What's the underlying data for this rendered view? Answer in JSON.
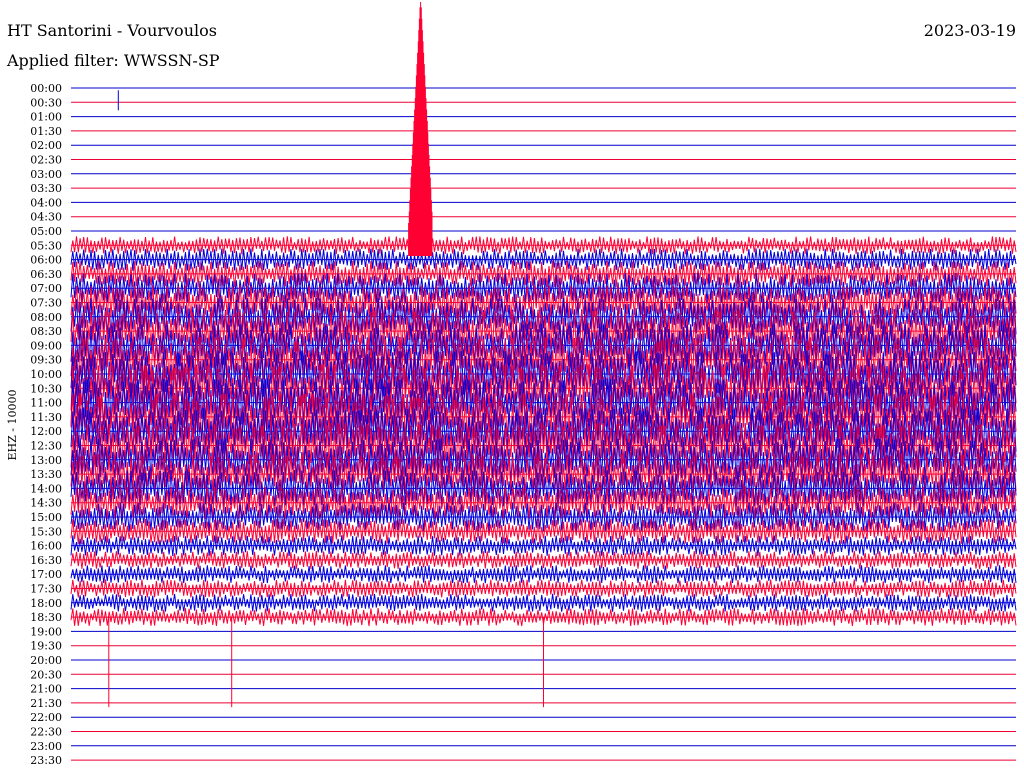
{
  "header": {
    "station": "HT Santorini - Vourvoulos",
    "filter_label": "Applied filter: WWSSN-SP",
    "date": "2023-03-19",
    "channel": "EHZ - 10000"
  },
  "colors": {
    "background": "#ffffff",
    "line_hour": "#0000cc",
    "line_half_hour": "#ee0033",
    "trace_blue": "#0000dd",
    "trace_red": "#ff0033",
    "text": "#000000"
  },
  "chart_data": {
    "type": "line",
    "title": "HT Santorini - Vourvoulos",
    "subtitle": "Applied filter: WWSSN-SP",
    "ylabel": "EHZ - 10000",
    "row_labels": [
      "00:00",
      "00:30",
      "01:00",
      "01:30",
      "02:00",
      "02:30",
      "03:00",
      "03:30",
      "04:00",
      "04:30",
      "05:00",
      "05:30",
      "06:00",
      "06:30",
      "07:00",
      "07:30",
      "08:00",
      "08:30",
      "09:00",
      "09:30",
      "10:00",
      "10:30",
      "11:00",
      "11:30",
      "12:00",
      "12:30",
      "13:00",
      "13:30",
      "14:00",
      "14:30",
      "15:00",
      "15:30",
      "16:00",
      "16:30",
      "17:00",
      "17:30",
      "18:00",
      "18:30",
      "19:00",
      "19:30",
      "20:00",
      "20:30",
      "21:00",
      "21:30",
      "22:00",
      "22:30",
      "23:00",
      "23:30"
    ],
    "series": [
      {
        "name": "",
        "color": "#0000dd",
        "description": "traces on :00 rows"
      },
      {
        "name": "",
        "color": "#ff0033",
        "description": "traces on :30 rows"
      }
    ],
    "active_window": {
      "start_row": "05:30",
      "end_row": "18:30"
    },
    "notable_events": [
      {
        "row": "00:30",
        "x_fraction": 0.05,
        "amplitude": "spike"
      },
      {
        "row": "05:00",
        "x_fraction": 0.37,
        "amplitude": "very large, saturated"
      },
      {
        "row": "18:30",
        "x_fraction": 0.04,
        "amplitude": "downward spike"
      },
      {
        "row": "18:30",
        "x_fraction": 0.17,
        "amplitude": "downward spike"
      },
      {
        "row": "18:30",
        "x_fraction": 0.5,
        "amplitude": "downward spike"
      }
    ]
  }
}
